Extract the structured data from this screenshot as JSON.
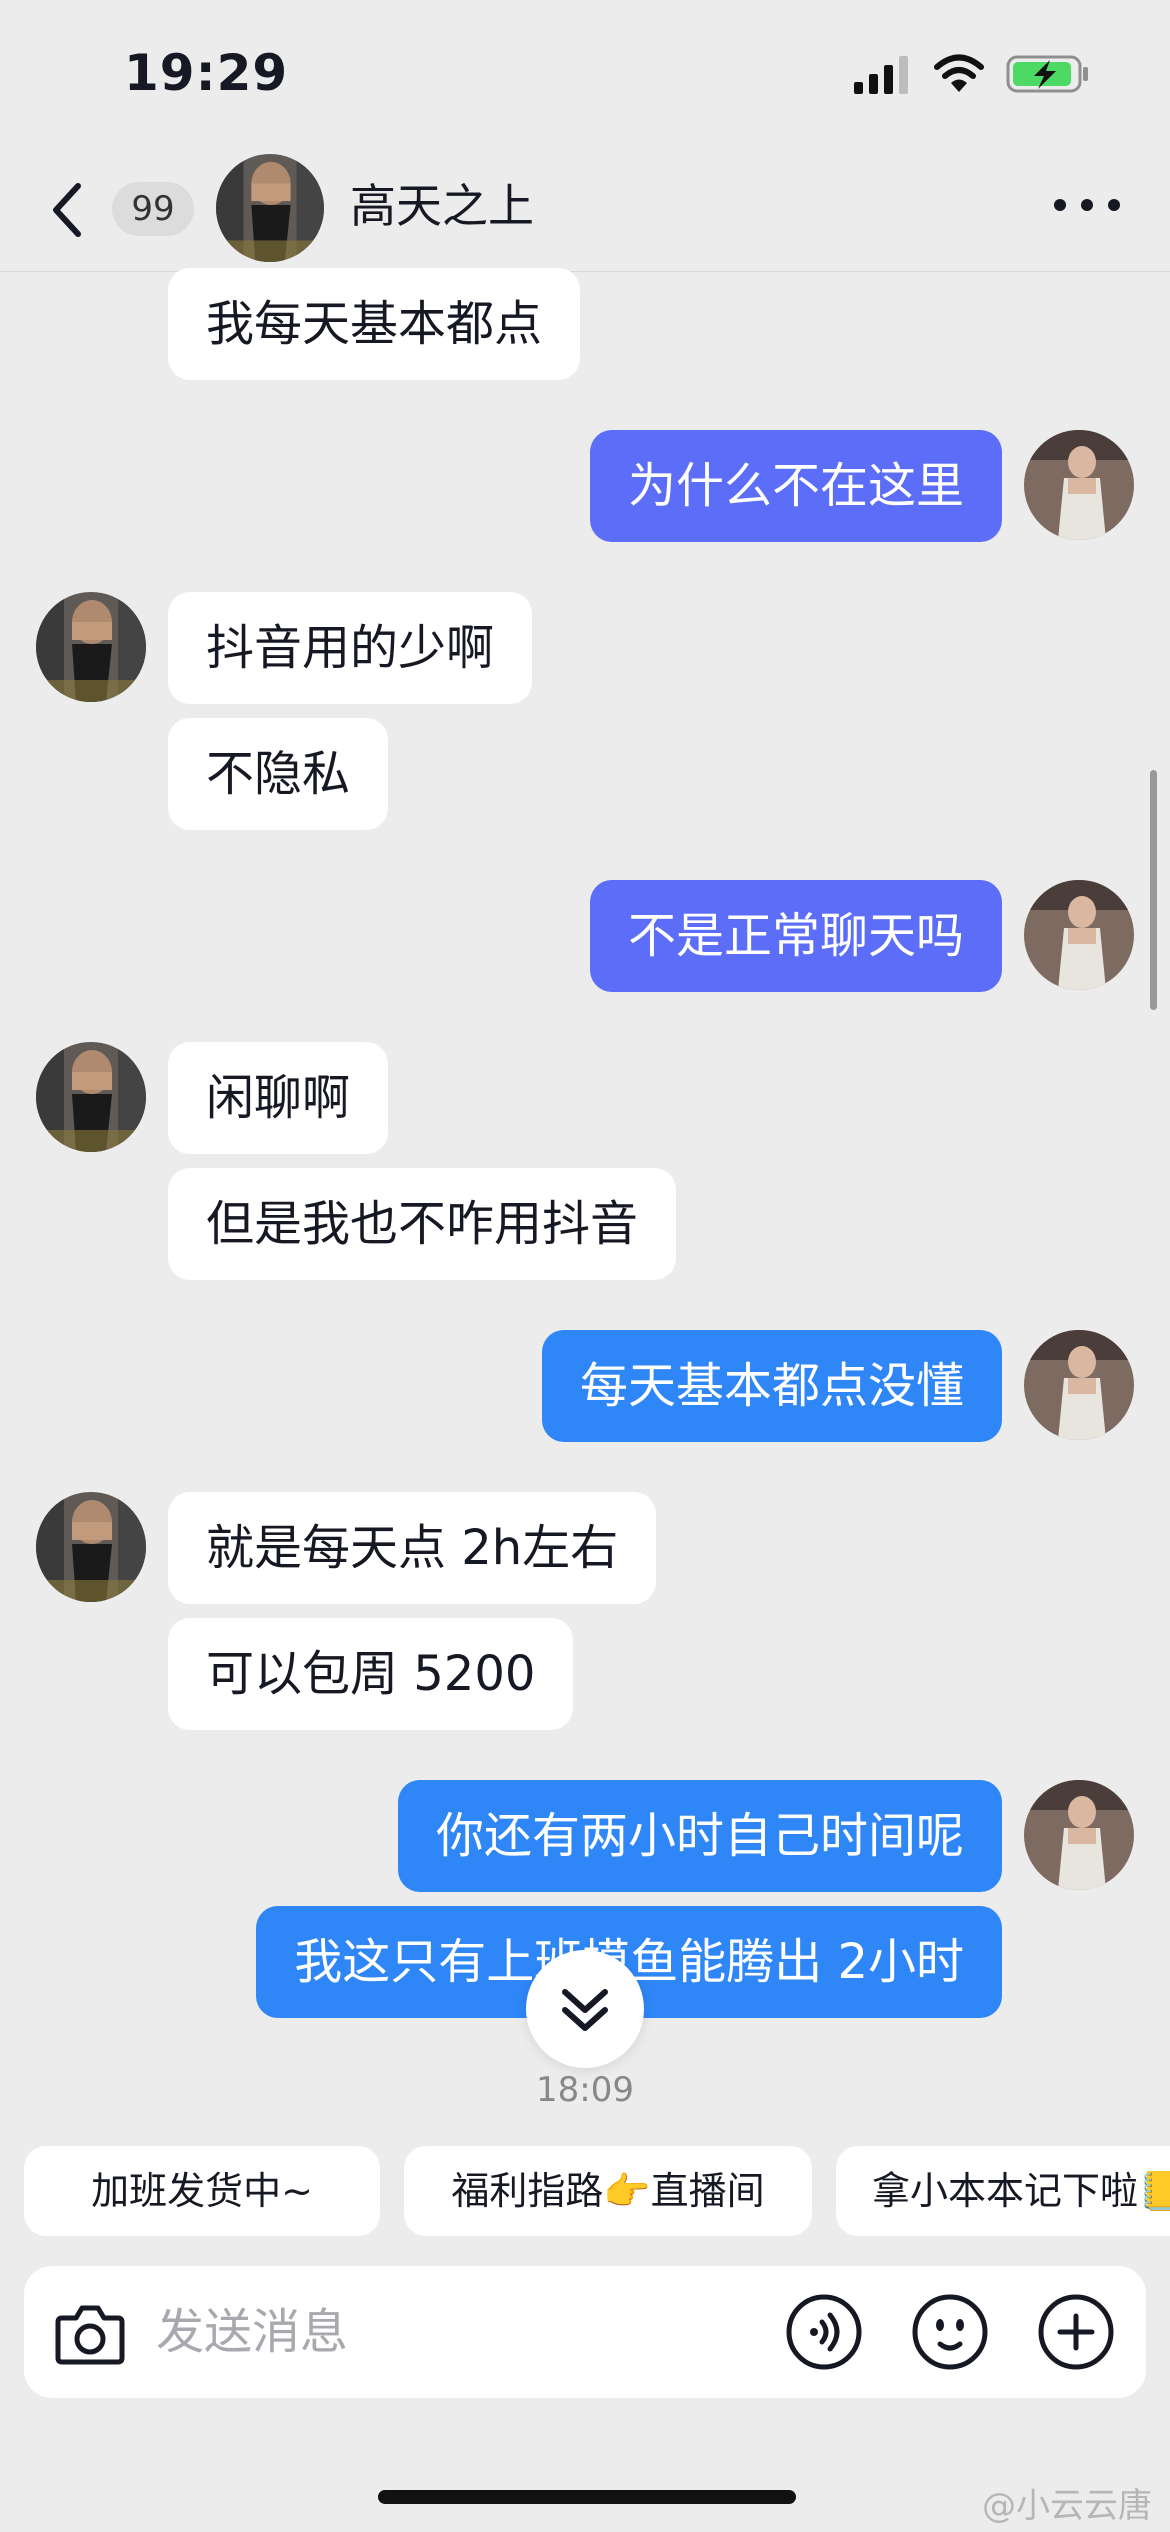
{
  "status": {
    "time": "19:29"
  },
  "header": {
    "unread_count": "99",
    "name": "高天之上"
  },
  "messages": [
    {
      "side": "in",
      "text": "我每天基本都点"
    },
    {
      "side": "out",
      "text": "为什么不在这里"
    },
    {
      "side": "in",
      "text": "抖音用的少啊"
    },
    {
      "side": "in",
      "text": "不隐私"
    },
    {
      "side": "out",
      "text": "不是正常聊天吗"
    },
    {
      "side": "in",
      "text": "闲聊啊"
    },
    {
      "side": "in",
      "text": "但是我也不咋用抖音"
    },
    {
      "side": "out",
      "text": "每天基本都点没懂"
    },
    {
      "side": "in",
      "text": "就是每天点 2h左右"
    },
    {
      "side": "in",
      "text": "可以包周 5200"
    },
    {
      "side": "out",
      "text": "你还有两小时自己时间呢"
    },
    {
      "side": "out",
      "text": "我这只有上班摸鱼能腾出 2小时"
    }
  ],
  "timestamp": "18:09",
  "quick_replies": [
    "加班发货中~",
    "福利指路👉直播间",
    "拿小本本记下啦📒"
  ],
  "input": {
    "placeholder": "发送消息"
  },
  "watermark": "@小云云唐",
  "colors": {
    "background": "#ececec",
    "incoming_bubble": "#ffffff",
    "outgoing_purple": "#5c6ef8",
    "outgoing_blue": "#2e86f7",
    "battery": "#4cd964"
  }
}
